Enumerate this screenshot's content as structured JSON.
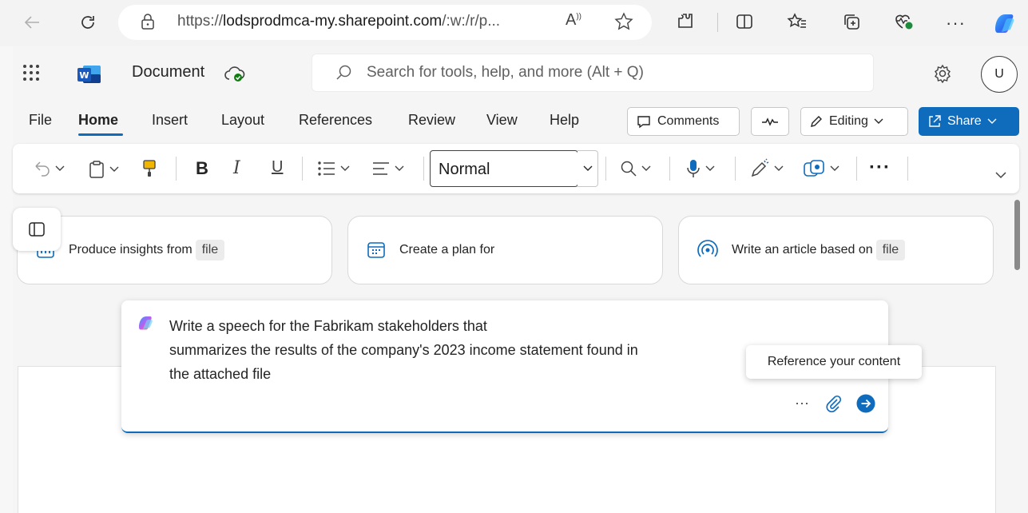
{
  "browser": {
    "url_prefix": "https://",
    "url_domain": "lodsprodmca-my.sharepoint.com",
    "url_rest": "/:w:/r/p..."
  },
  "app": {
    "doc_title": "Document",
    "search_placeholder": "Search for tools, help, and more (Alt + Q)",
    "avatar_initial": "U"
  },
  "tabs": [
    "File",
    "Home",
    "Insert",
    "Layout",
    "References",
    "Review",
    "View",
    "Help"
  ],
  "actions": {
    "comments": "Comments",
    "editing": "Editing",
    "share": "Share"
  },
  "toolbar": {
    "style_value": "Normal",
    "bold": "B",
    "italic": "I",
    "underline": "U",
    "more": "···"
  },
  "suggestions": [
    {
      "text": "Produce insights from",
      "chip": "file",
      "icon": "chart-icon"
    },
    {
      "text": "Create a plan for",
      "chip": "",
      "icon": "calendar-icon"
    },
    {
      "text": "Write an article based on",
      "chip": "file",
      "icon": "broadcast-icon"
    }
  ],
  "prompt": {
    "line1": "Write a speech for the Fabrikam stakeholders that",
    "line2": "summarizes the results of the company's 2023 income statement found in",
    "line3": "the attached file",
    "more": "···"
  },
  "tooltip": "Reference your content",
  "colors": {
    "accent": "#0f6cbd",
    "word_blue": "#185abd"
  }
}
